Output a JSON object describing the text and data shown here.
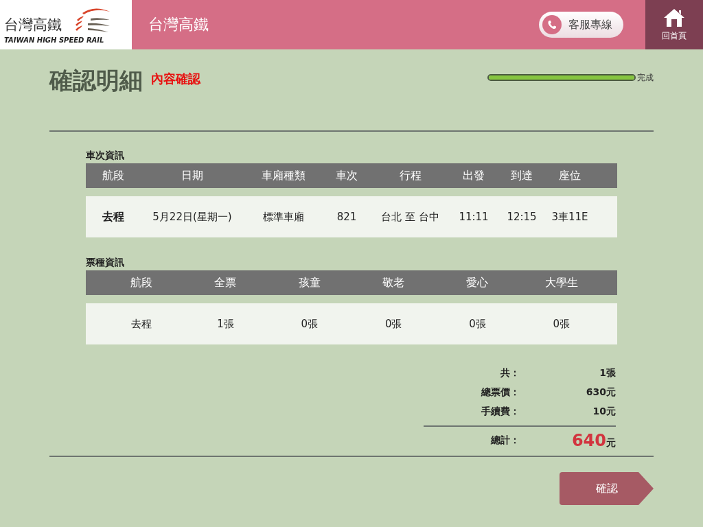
{
  "header": {
    "logo_text": "台灣高鐵",
    "logo_subtext": "TAIWAN HIGH SPEED RAIL",
    "title": "台灣高鐵",
    "hotline_button": "客服專線",
    "home_button": "回首頁"
  },
  "page": {
    "title": "確認明細",
    "subtitle": "內容確認",
    "progress": {
      "level": 1,
      "label": "完成"
    }
  },
  "train_info": {
    "heading": "車次資訊",
    "columns": [
      "航段",
      "日期",
      "車廂種類",
      "車次",
      "行程",
      "出發",
      "到達",
      "座位"
    ],
    "rows": [
      [
        "去程",
        "5月22日(星期一)",
        "標準車廂",
        "821",
        "台北 至 台中",
        "11:11",
        "12:15",
        "3車11E"
      ]
    ]
  },
  "ticket_info": {
    "heading": "票種資訊",
    "columns": [
      "航段",
      "全票",
      "孩童",
      "敬老",
      "愛心",
      "大學生"
    ],
    "rows": [
      [
        "去程",
        "1張",
        "0張",
        "0張",
        "0張",
        "0張"
      ]
    ]
  },
  "summary": {
    "lines": [
      {
        "label": "共：",
        "value": "1張"
      },
      {
        "label": "總票價：",
        "value": "630元"
      },
      {
        "label": "手續費：",
        "value": "10元"
      }
    ],
    "total": {
      "label": "總計：",
      "amount": "640",
      "unit": "元"
    }
  },
  "confirm_button": "確認"
}
